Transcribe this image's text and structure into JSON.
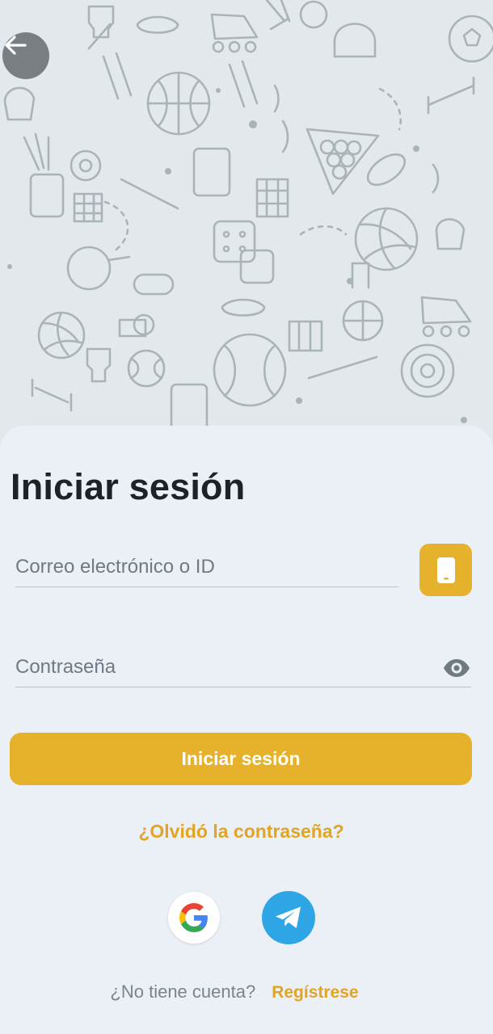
{
  "header": {
    "back_icon": "arrow-left-icon",
    "background_pattern": "sports-doodle-pattern"
  },
  "login": {
    "title": "Iniciar sesión",
    "email_placeholder": "Correo electrónico o ID",
    "email_value": "",
    "phone_toggle_icon": "smartphone-icon",
    "password_placeholder": "Contraseña",
    "password_value": "",
    "show_password_icon": "eye-icon",
    "submit_label": "Iniciar sesión",
    "forgot_label": "¿Olvidó la contraseña?",
    "social": [
      {
        "name": "Google",
        "icon": "google-icon"
      },
      {
        "name": "Telegram",
        "icon": "telegram-icon"
      }
    ],
    "no_account_text": "¿No tiene cuenta?",
    "register_label": "Regístrese"
  },
  "colors": {
    "accent": "#e7b22b",
    "link": "#e2a523",
    "sheet_bg": "#ebeff6",
    "telegram": "#2ea6e6"
  }
}
